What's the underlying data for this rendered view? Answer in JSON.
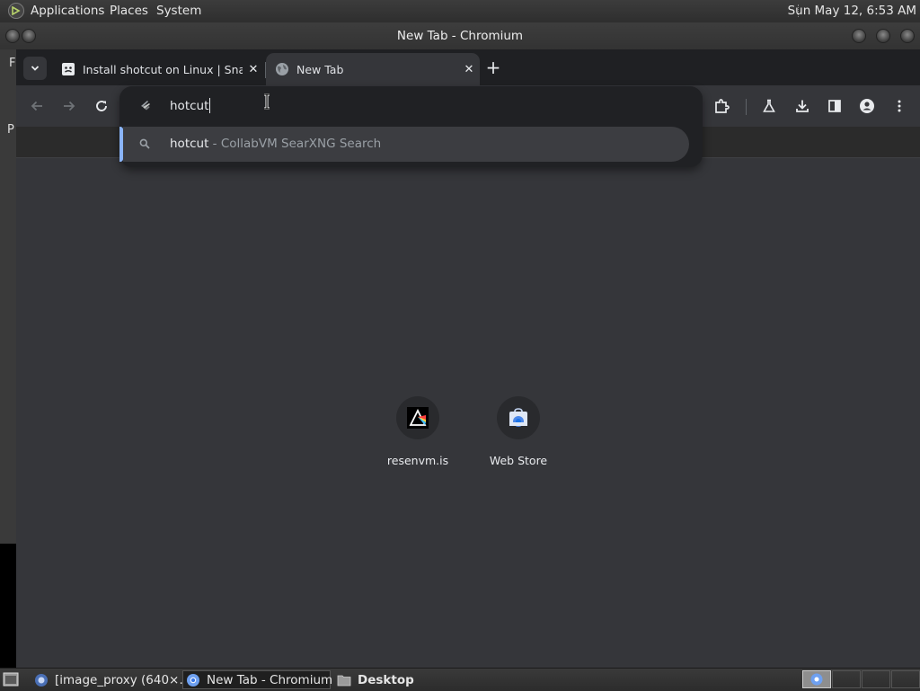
{
  "top_panel": {
    "menus": [
      "Applications",
      "Places",
      "System"
    ],
    "clock": "Sun May 12,  6:53 AM"
  },
  "background_window": {
    "letters": [
      "F",
      "P"
    ]
  },
  "window": {
    "title": "New Tab - Chromium",
    "tabs": [
      {
        "title": "Install shotcut on Linux | Snap",
        "active": false,
        "favicon": "snapcraft-icon"
      },
      {
        "title": "New Tab",
        "active": true,
        "favicon": "globe-icon"
      }
    ],
    "omnibox": {
      "value": "hotcut",
      "suggestion": {
        "query": "hotcut",
        "description": " - CollabVM SearXNG Search"
      }
    },
    "shortcuts": [
      {
        "label": "resenvm.is",
        "icon": "resenvm-icon"
      },
      {
        "label": "Web Store",
        "icon": "web-store-icon"
      }
    ]
  },
  "taskbar": {
    "tasks": [
      {
        "label": "[image_proxy (640×…",
        "icon": "browser-icon"
      },
      {
        "label": "New Tab - Chromium",
        "icon": "chromium-icon",
        "active": true
      },
      {
        "label": "Desktop",
        "icon": "folder-icon"
      }
    ]
  },
  "colors": {
    "toolbar": "#35363a",
    "tabstrip": "#1f2023",
    "omnibox_bg": "#202124",
    "suggestion_accent": "#8ab4f8"
  }
}
